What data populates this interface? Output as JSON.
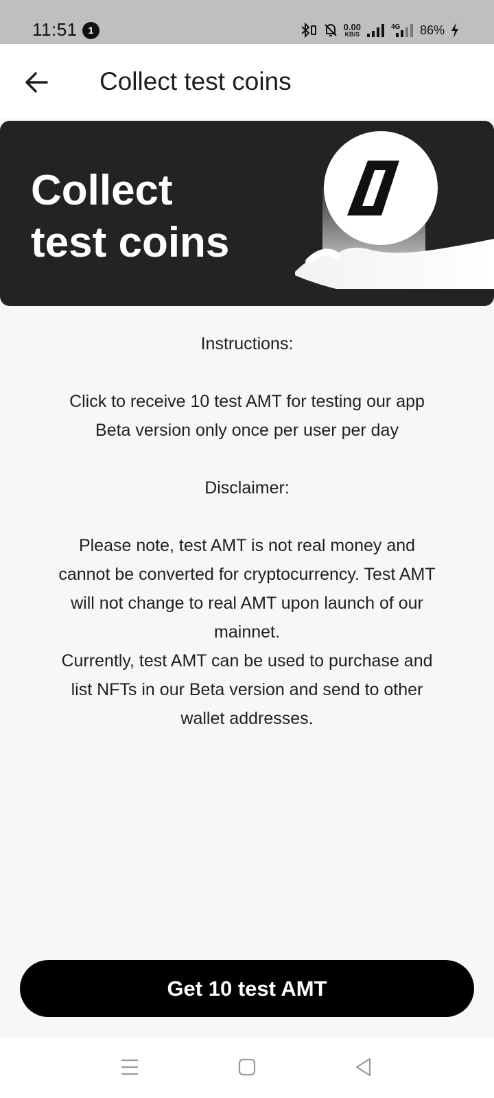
{
  "status_bar": {
    "time": "11:51",
    "notification_count": "1",
    "net_speed_value": "0.00",
    "net_speed_unit": "KB/S",
    "network_type": "4G",
    "battery": "86%"
  },
  "app_bar": {
    "title": "Collect test coins"
  },
  "banner": {
    "title_line1": "Collect",
    "title_line2": "test coins"
  },
  "content": {
    "instructions_heading": "Instructions:",
    "instructions_line1": "Click to receive 10 test AMT for testing our app",
    "instructions_line2": "Beta version only once per user per day",
    "disclaimer_heading": "Disclaimer:",
    "disclaimer_line1": "Please note, test AMT is not real money and",
    "disclaimer_line2": "cannot be converted for cryptocurrency. Test AMT",
    "disclaimer_line3": "will not change to real AMT upon launch of our",
    "disclaimer_line4": "mainnet.",
    "disclaimer_line5": "Currently, test AMT can be used to purchase and",
    "disclaimer_line6": "list NFTs in our Beta version and send to other",
    "disclaimer_line7": "wallet addresses."
  },
  "cta": {
    "label": "Get 10 test AMT"
  },
  "icons": {
    "back": "arrow-left-icon",
    "logo": "bracket-logo-icon",
    "nav_menu": "menu-icon",
    "nav_home": "square-icon",
    "nav_back": "triangle-back-icon"
  },
  "colors": {
    "banner_bg": "#232323",
    "button_bg": "#000000",
    "page_bg": "#f7f7f7",
    "status_bar_bg": "#bfbfbf"
  }
}
